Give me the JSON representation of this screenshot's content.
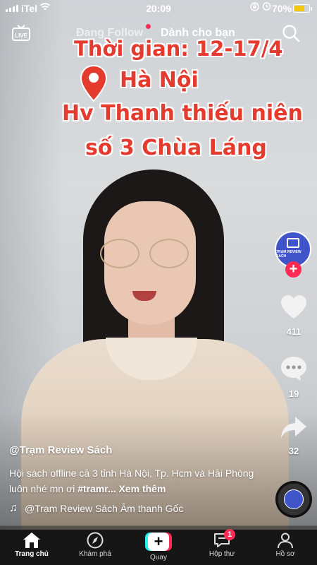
{
  "status_bar": {
    "carrier": "iTel",
    "time": "20:09",
    "battery_percent": "70%",
    "battery_level": 0.7,
    "battery_color": "#f2c70e"
  },
  "top_nav": {
    "live_icon": "live-tv-icon",
    "tabs": [
      {
        "label": "Đang Follow",
        "active": false
      },
      {
        "label": "Dành cho bạn",
        "active": true
      }
    ],
    "search_icon": "search-icon"
  },
  "overlay": {
    "line1": "Thời gian: 12-17/4",
    "line2": "Hà Nội",
    "line3": "Hv Thanh thiếu niên",
    "line4": "số 3 Chùa Láng",
    "text_color": "#e53b2e",
    "pin_icon": "location-pin-icon"
  },
  "right_rail": {
    "avatar_text": "TRẠM REVIEW SÁCH",
    "likes": "411",
    "comments": "19",
    "shares": "32"
  },
  "caption": {
    "author": "@Trạm Review Sách",
    "description": "Hội sách offline cả 3 tỉnh Hà Nội, Tp. Hcm và Hải Phòng luôn nhé mn ơi ",
    "hashtag": "#tramr...",
    "see_more": "Xem thêm",
    "music": "@Trạm Review Sách Âm thanh Gốc"
  },
  "bottom_nav": {
    "items": [
      {
        "label": "Trang chủ",
        "icon": "home-icon",
        "active": true
      },
      {
        "label": "Khám phá",
        "icon": "compass-icon",
        "active": false
      },
      {
        "label": "Quay",
        "icon": "create-plus-icon",
        "active": false
      },
      {
        "label": "Hộp thư",
        "icon": "inbox-icon",
        "active": false,
        "badge": "1"
      },
      {
        "label": "Hồ sơ",
        "icon": "profile-icon",
        "active": false
      }
    ]
  },
  "colors": {
    "accent": "#fe2c55",
    "teal": "#25f4ee"
  }
}
